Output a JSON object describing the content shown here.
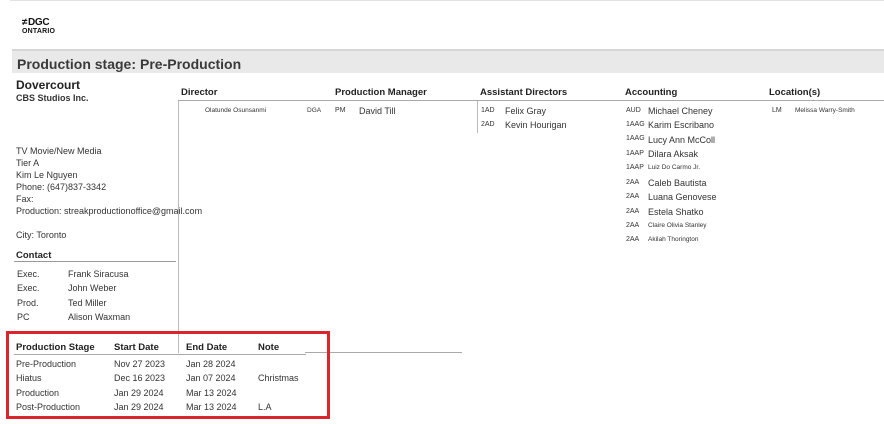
{
  "logo": {
    "line1": "DGC",
    "line2": "ONTARIO"
  },
  "stage": {
    "label": "Production stage:",
    "value": "Pre-Production"
  },
  "project": {
    "title": "Dovercourt",
    "studio": "CBS Studios Inc.",
    "type": "TV Movie/New Media",
    "tier": "Tier A",
    "contact_name": "Kim Le Nguyen",
    "phone": "Phone: (647)837-3342",
    "fax": "Fax:",
    "production_email": "Production: streakproductionoffice@gmail.com",
    "city": "City:  Toronto"
  },
  "contact": {
    "header": "Contact",
    "rows": [
      {
        "role": "Exec.",
        "name": "Frank Siracusa"
      },
      {
        "role": "Exec.",
        "name": "John Weber"
      },
      {
        "role": "Prod.",
        "name": "Ted Miller"
      },
      {
        "role": "PC",
        "name": "Alison Waxman"
      }
    ]
  },
  "director": {
    "header": "Director",
    "name": "Olatunde  Osunsanmi",
    "union": "DGA"
  },
  "production_manager": {
    "header": "Production Manager",
    "role": "PM",
    "name": "David Till"
  },
  "assistant_directors": {
    "header": "Assistant Directors",
    "rows": [
      {
        "role": "1AD",
        "name": "Felix Gray"
      },
      {
        "role": "2AD",
        "name": "Kevin Hourigan"
      }
    ]
  },
  "accounting": {
    "header": "Accounting",
    "rows": [
      {
        "role": "AUD",
        "name": "Michael Cheney",
        "size": "med"
      },
      {
        "role": "1AAG",
        "name": "Karim Escribano",
        "size": "med"
      },
      {
        "role": "1AAG",
        "name": "Lucy Ann McColl",
        "size": "med"
      },
      {
        "role": "1AAP",
        "name": "Dilara Aksak",
        "size": "med"
      },
      {
        "role": "1AAP",
        "name": "Luiz Do Carmo Jr.",
        "size": "small"
      },
      {
        "role": "2AA",
        "name": "Caleb Bautista",
        "size": "med"
      },
      {
        "role": "2AA",
        "name": "Luana Genovese",
        "size": "med"
      },
      {
        "role": "2AA",
        "name": "Estela Shatko",
        "size": "med"
      },
      {
        "role": "2AA",
        "name": "Claire Olivia Stanley",
        "size": "small"
      },
      {
        "role": "2AA",
        "name": "Akilah Thorington",
        "size": "small"
      }
    ]
  },
  "locations": {
    "header": "Location(s)",
    "role": "LM",
    "name": "Melissa Warry-Smith"
  },
  "schedule": {
    "headers": {
      "stage": "Production Stage",
      "start": "Start Date",
      "end": "End Date",
      "note": "Note"
    },
    "rows": [
      {
        "stage": "Pre-Production",
        "start": "Nov 27 2023",
        "end": "Jan 28 2024",
        "note": ""
      },
      {
        "stage": "Hiatus",
        "start": "Dec 16 2023",
        "end": "Jan 07 2024",
        "note": "Christmas"
      },
      {
        "stage": "Production",
        "start": "Jan 29 2024",
        "end": "Mar 13 2024",
        "note": ""
      },
      {
        "stage": "Post-Production",
        "start": "Jan 29 2024",
        "end": "Mar 13 2024",
        "note": "L.A"
      }
    ]
  }
}
